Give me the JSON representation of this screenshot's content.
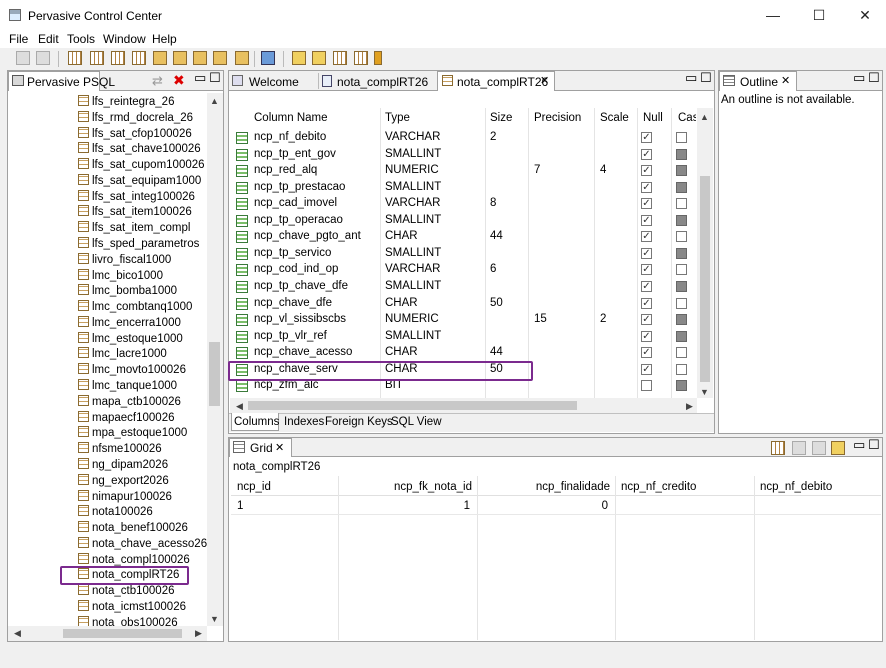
{
  "window": {
    "title": "Pervasive Control Center",
    "minimize": "—",
    "maximize": "☐",
    "close": "✕"
  },
  "menu": [
    "File",
    "Edit",
    "Tools",
    "Window",
    "Help"
  ],
  "left_panel": {
    "title": "Pervasive PSQL",
    "items": [
      "lfs_reintegra_26",
      "lfs_rmd_docrela_26",
      "lfs_sat_cfop100026",
      "lfs_sat_chave100026",
      "lfs_sat_cupom100026",
      "lfs_sat_equipam1000",
      "lfs_sat_integ100026",
      "lfs_sat_item100026",
      "lfs_sat_item_compl",
      "lfs_sped_parametros",
      "livro_fiscal1000",
      "lmc_bico1000",
      "lmc_bomba1000",
      "lmc_combtanq1000",
      "lmc_encerra1000",
      "lmc_estoque1000",
      "lmc_lacre1000",
      "lmc_movto100026",
      "lmc_tanque1000",
      "mapa_ctb100026",
      "mapaecf100026",
      "mpa_estoque1000",
      "nfsme100026",
      "ng_dipam2026",
      "ng_export2026",
      "nimapur100026",
      "nota100026",
      "nota_benef100026",
      "nota_chave_acesso26",
      "nota_compl100026",
      "nota_complRT26",
      "nota_ctb100026",
      "nota_icmst100026",
      "nota_obs100026"
    ]
  },
  "editor": {
    "tabs": [
      "Welcome",
      "nota_complRT26",
      "nota_complRT26"
    ],
    "columns": [
      "Column Name",
      "Type",
      "Size",
      "Precision",
      "Scale",
      "Null",
      "Case"
    ],
    "rows": [
      {
        "name": "ncp_nf_debito",
        "type": "VARCHAR",
        "size": "2",
        "precision": "",
        "scale": "",
        "null": true,
        "case": "white"
      },
      {
        "name": "ncp_tp_ent_gov",
        "type": "SMALLINT",
        "size": "",
        "precision": "",
        "scale": "",
        "null": true,
        "case": "gray"
      },
      {
        "name": "ncp_red_alq",
        "type": "NUMERIC",
        "size": "",
        "precision": "7",
        "scale": "4",
        "null": true,
        "case": "gray"
      },
      {
        "name": "ncp_tp_prestacao",
        "type": "SMALLINT",
        "size": "",
        "precision": "",
        "scale": "",
        "null": true,
        "case": "gray"
      },
      {
        "name": "ncp_cad_imovel",
        "type": "VARCHAR",
        "size": "8",
        "precision": "",
        "scale": "",
        "null": true,
        "case": "white"
      },
      {
        "name": "ncp_tp_operacao",
        "type": "SMALLINT",
        "size": "",
        "precision": "",
        "scale": "",
        "null": true,
        "case": "gray"
      },
      {
        "name": "ncp_chave_pgto_ant",
        "type": "CHAR",
        "size": "44",
        "precision": "",
        "scale": "",
        "null": true,
        "case": "white"
      },
      {
        "name": "ncp_tp_servico",
        "type": "SMALLINT",
        "size": "",
        "precision": "",
        "scale": "",
        "null": true,
        "case": "gray"
      },
      {
        "name": "ncp_cod_ind_op",
        "type": "VARCHAR",
        "size": "6",
        "precision": "",
        "scale": "",
        "null": true,
        "case": "white"
      },
      {
        "name": "ncp_tp_chave_dfe",
        "type": "SMALLINT",
        "size": "",
        "precision": "",
        "scale": "",
        "null": true,
        "case": "gray"
      },
      {
        "name": "ncp_chave_dfe",
        "type": "CHAR",
        "size": "50",
        "precision": "",
        "scale": "",
        "null": true,
        "case": "white"
      },
      {
        "name": "ncp_vl_sissibscbs",
        "type": "NUMERIC",
        "size": "",
        "precision": "15",
        "scale": "2",
        "null": true,
        "case": "gray"
      },
      {
        "name": "ncp_tp_vlr_ref",
        "type": "SMALLINT",
        "size": "",
        "precision": "",
        "scale": "",
        "null": true,
        "case": "gray"
      },
      {
        "name": "ncp_chave_acesso",
        "type": "CHAR",
        "size": "44",
        "precision": "",
        "scale": "",
        "null": true,
        "case": "white"
      },
      {
        "name": "ncp_chave_serv",
        "type": "CHAR",
        "size": "50",
        "precision": "",
        "scale": "",
        "null": true,
        "case": "white"
      },
      {
        "name": "ncp_zfm_alc",
        "type": "BIT",
        "size": "",
        "precision": "",
        "scale": "",
        "null": false,
        "case": "gray"
      }
    ],
    "bottom_tabs": [
      "Columns",
      "Indexes",
      "Foreign Keys",
      "SQL View"
    ]
  },
  "outline": {
    "title": "Outline",
    "message": "An outline is not available."
  },
  "grid": {
    "title": "Grid",
    "table": "nota_complRT26",
    "headers": [
      "ncp_id",
      "ncp_fk_nota_id",
      "ncp_finalidade",
      "ncp_nf_credito",
      "ncp_nf_debito"
    ],
    "row": [
      "1",
      "1",
      "0",
      "",
      ""
    ]
  },
  "colors": {
    "highlight": "#7b2a8e",
    "selected_tab": "#ffffff"
  }
}
